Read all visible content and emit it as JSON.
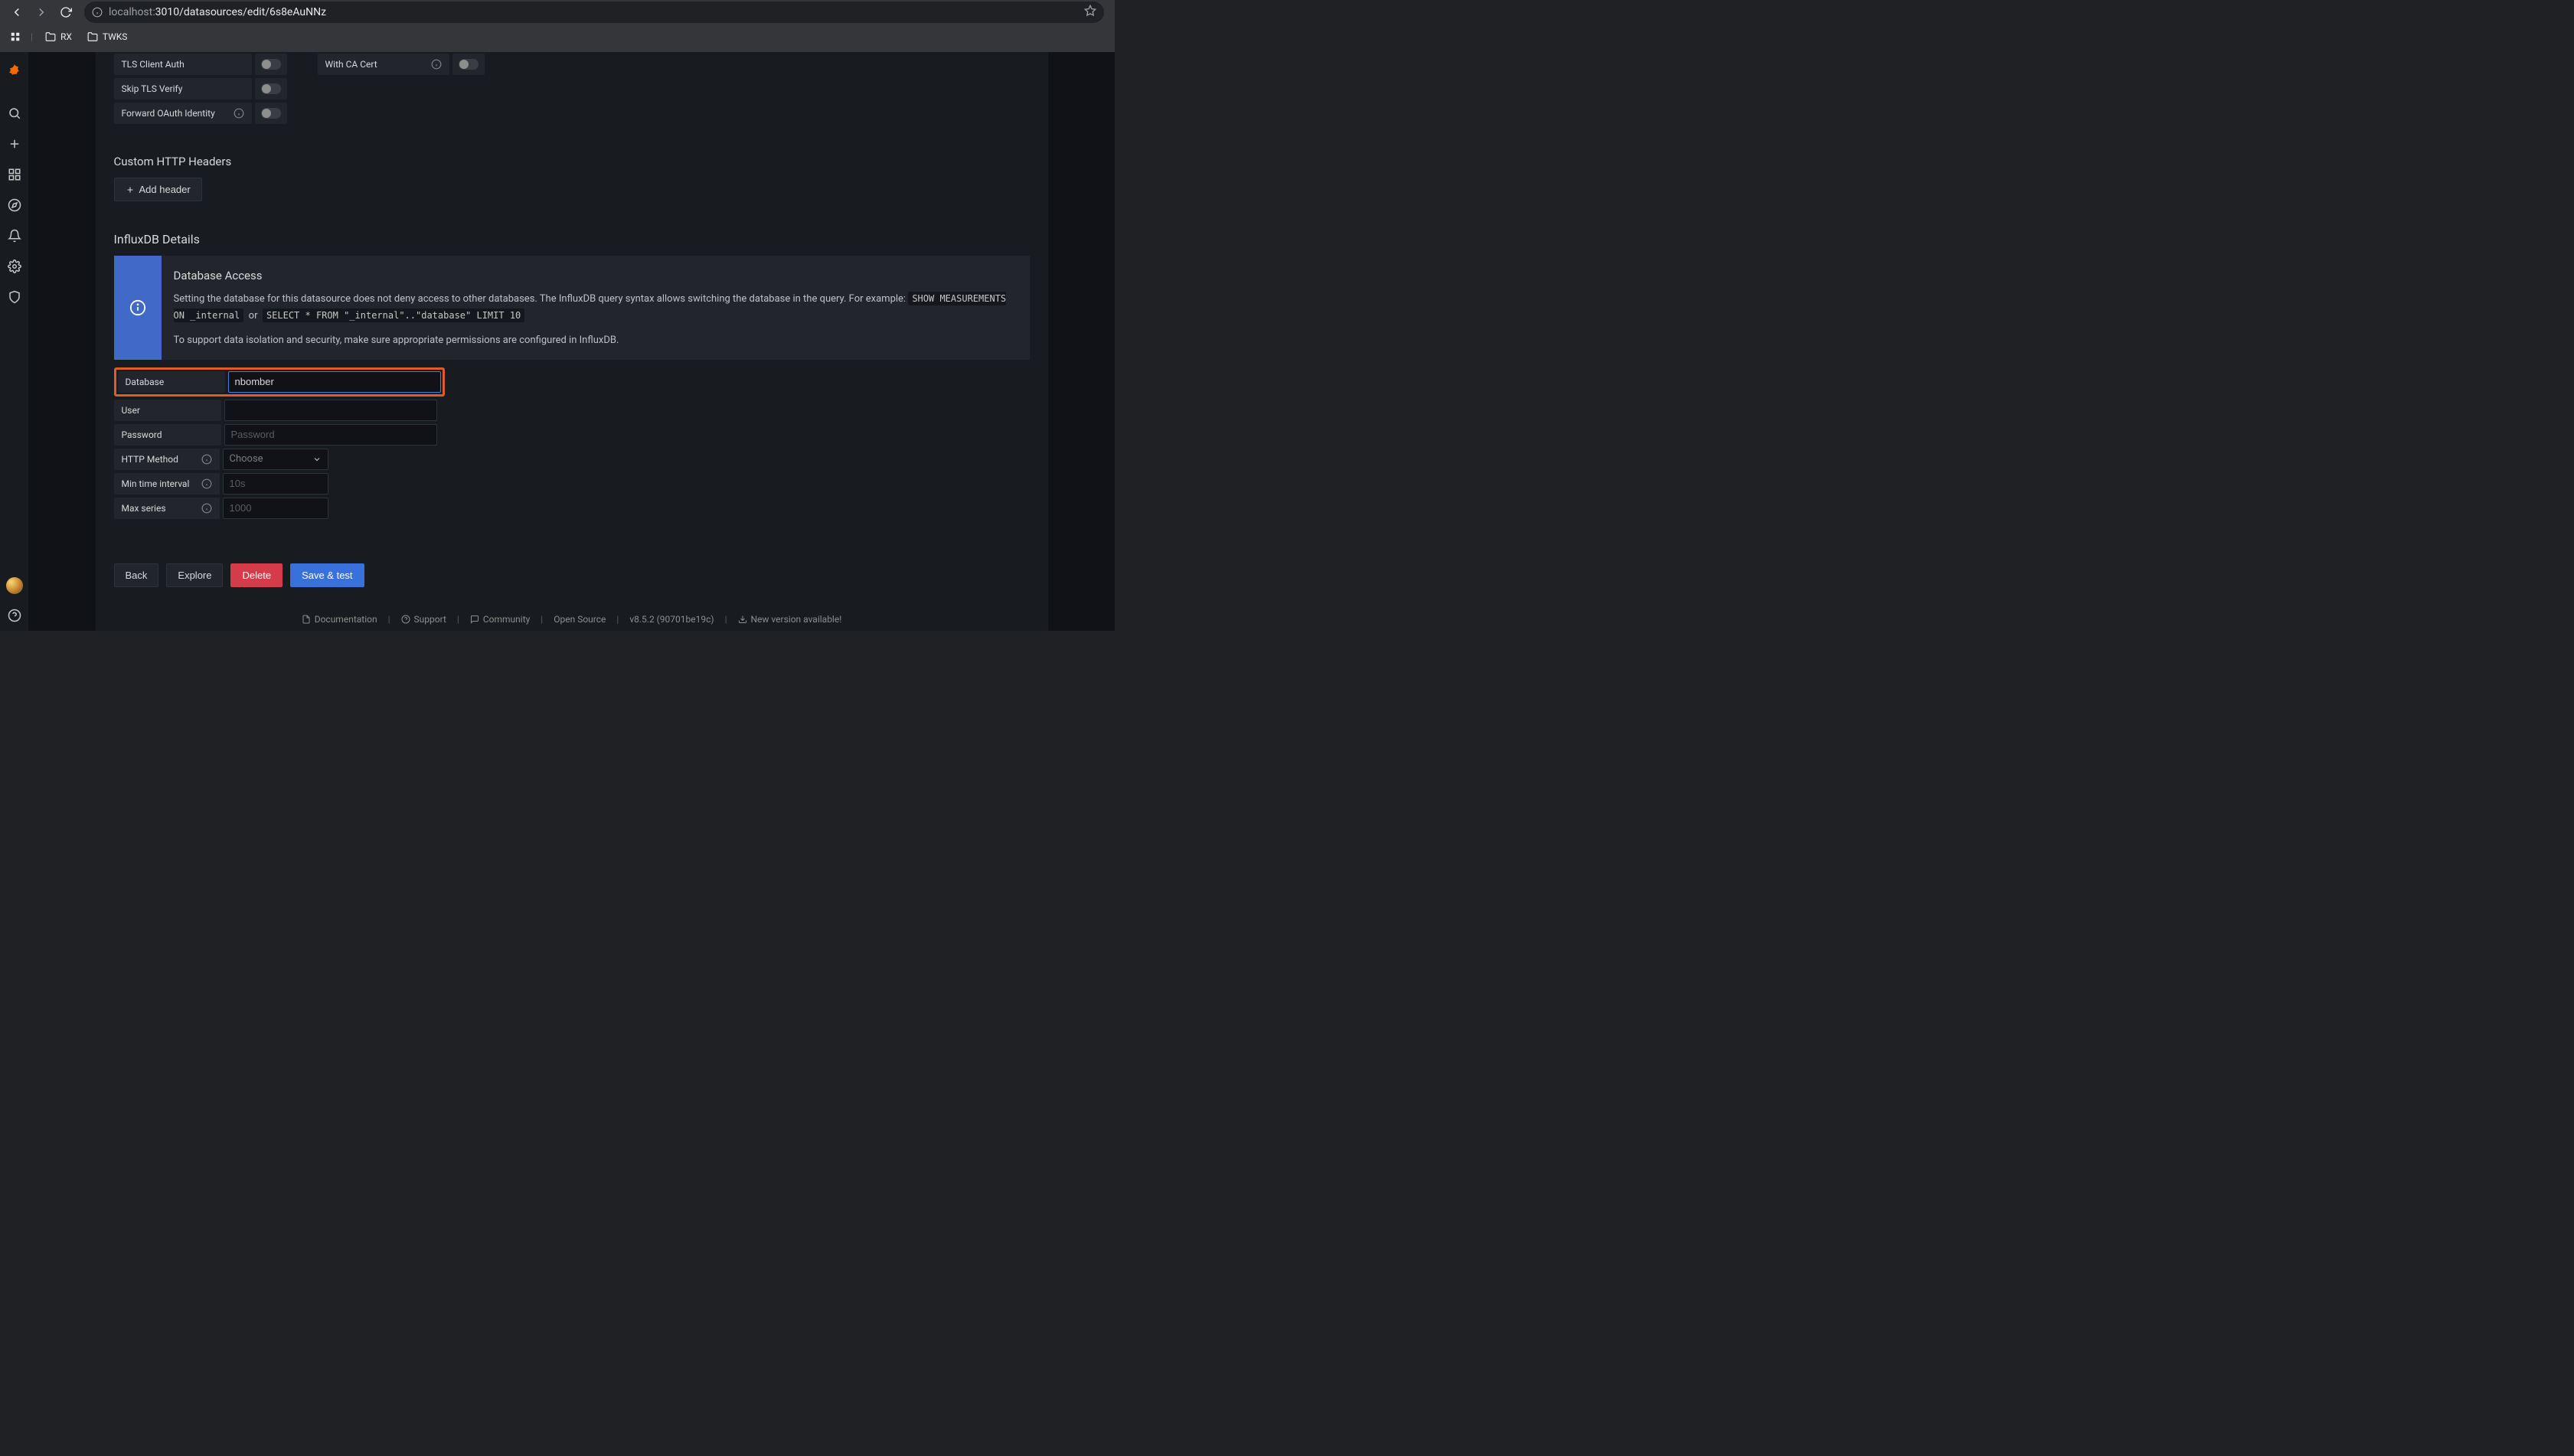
{
  "browser": {
    "url_host": "localhost:",
    "url_path": "3010/datasources/edit/6s8eAuNNz",
    "bookmarks": [
      {
        "label": "RX"
      },
      {
        "label": "TWKS"
      }
    ]
  },
  "auth": {
    "tls_client_auth": "TLS Client Auth",
    "with_ca_cert": "With CA Cert",
    "skip_tls_verify": "Skip TLS Verify",
    "forward_oauth": "Forward OAuth Identity"
  },
  "custom_headers": {
    "heading": "Custom HTTP Headers",
    "add_button": "Add header"
  },
  "details": {
    "heading": "InfluxDB Details",
    "alert_title": "Database Access",
    "alert_line1": "Setting the database for this datasource does not deny access to other databases. The InfluxDB query syntax allows switching the database in the query. For example:",
    "alert_code1": "SHOW MEASUREMENTS ON _internal",
    "alert_or": "or",
    "alert_code2": "SELECT * FROM \"_internal\"..\"database\" LIMIT 10",
    "alert_line2": "To support data isolation and security, make sure appropriate permissions are configured in InfluxDB.",
    "fields": {
      "database_label": "Database",
      "database_value": "nbomber",
      "user_label": "User",
      "user_value": "",
      "password_label": "Password",
      "password_placeholder": "Password",
      "http_method_label": "HTTP Method",
      "http_method_placeholder": "Choose",
      "min_interval_label": "Min time interval",
      "min_interval_placeholder": "10s",
      "max_series_label": "Max series",
      "max_series_placeholder": "1000"
    }
  },
  "buttons": {
    "back": "Back",
    "explore": "Explore",
    "delete": "Delete",
    "save_test": "Save & test"
  },
  "footer": {
    "documentation": "Documentation",
    "support": "Support",
    "community": "Community",
    "opensource": "Open Source",
    "version": "v8.5.2 (90701be19c)",
    "new_version": "New version available!"
  }
}
